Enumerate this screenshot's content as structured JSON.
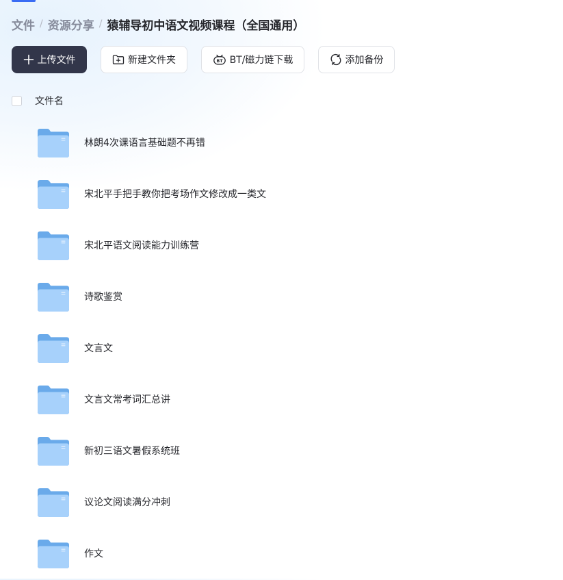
{
  "breadcrumb": {
    "root": "文件",
    "parent": "资源分享",
    "current": "猿辅导初中语文视频课程（全国通用）",
    "separator": "/"
  },
  "toolbar": {
    "upload_label": "上传文件",
    "new_folder_label": "新建文件夹",
    "bt_label": "BT/磁力链下载",
    "backup_label": "添加备份"
  },
  "list_header": {
    "filename_label": "文件名"
  },
  "files": [
    {
      "name": "林朗4次课语言基础题不再错",
      "type": "folder"
    },
    {
      "name": "宋北平手把手教你把考场作文修改成一类文",
      "type": "folder"
    },
    {
      "name": "宋北平语文阅读能力训练营",
      "type": "folder"
    },
    {
      "name": "诗歌鉴赏",
      "type": "folder"
    },
    {
      "name": "文言文",
      "type": "folder"
    },
    {
      "name": "文言文常考词汇总讲",
      "type": "folder"
    },
    {
      "name": "新初三语文暑假系统班",
      "type": "folder"
    },
    {
      "name": "议论文阅读满分冲刺",
      "type": "folder"
    },
    {
      "name": "作文",
      "type": "folder"
    }
  ],
  "colors": {
    "accent": "#3a6cf4",
    "primary_button": "#32364a",
    "folder_back": "#6aaaea",
    "folder_front": "#a7d1fb"
  },
  "icons": {
    "upload": "plus-icon",
    "new_folder": "folder-plus-icon",
    "bt": "bt-icon",
    "backup": "refresh-icon",
    "file": "folder-icon"
  }
}
